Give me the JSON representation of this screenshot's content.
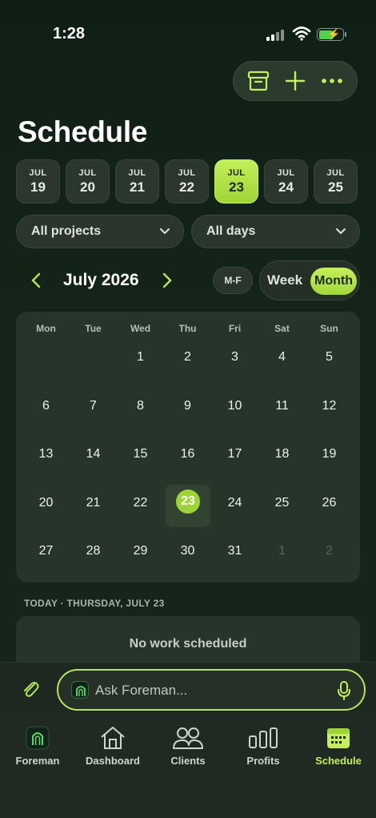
{
  "status": {
    "time": "1:28"
  },
  "header": {
    "title": "Schedule"
  },
  "toolbar": {
    "icons": [
      "archive-icon",
      "plus-icon",
      "more-icon"
    ]
  },
  "date_strip": [
    {
      "month": "JUL",
      "day": "19"
    },
    {
      "month": "JUL",
      "day": "20"
    },
    {
      "month": "JUL",
      "day": "21"
    },
    {
      "month": "JUL",
      "day": "22"
    },
    {
      "month": "JUL",
      "day": "23",
      "selected": true
    },
    {
      "month": "JUL",
      "day": "24"
    },
    {
      "month": "JUL",
      "day": "25"
    }
  ],
  "filters": {
    "projects": "All projects",
    "days": "All days"
  },
  "month_nav": {
    "label": "July 2026",
    "mf_label": "M-F",
    "week_label": "Week",
    "month_label": "Month",
    "active_view": "Month"
  },
  "calendar": {
    "weekdays": [
      "Mon",
      "Tue",
      "Wed",
      "Thu",
      "Fri",
      "Sat",
      "Sun"
    ],
    "weeks": [
      [
        "",
        "",
        "1",
        "2",
        "3",
        "4",
        "5"
      ],
      [
        "6",
        "7",
        "8",
        "9",
        "10",
        "11",
        "12"
      ],
      [
        "13",
        "14",
        "15",
        "16",
        "17",
        "18",
        "19"
      ],
      [
        "20",
        "21",
        "22",
        "23",
        "24",
        "25",
        "26"
      ],
      [
        "27",
        "28",
        "29",
        "30",
        "31",
        "1",
        "2"
      ]
    ],
    "today": "23"
  },
  "agenda": {
    "today_label": "TODAY · THURSDAY, JULY 23",
    "empty_text": "No work scheduled"
  },
  "ask": {
    "placeholder": "Ask Foreman..."
  },
  "tabs": [
    {
      "label": "Foreman",
      "icon": "foreman-logo-icon",
      "active": false
    },
    {
      "label": "Dashboard",
      "icon": "home-icon",
      "active": false
    },
    {
      "label": "Clients",
      "icon": "clients-icon",
      "active": false
    },
    {
      "label": "Profits",
      "icon": "bar-chart-icon",
      "active": false
    },
    {
      "label": "Schedule",
      "icon": "calendar-icon",
      "active": true
    }
  ],
  "colors": {
    "accent": "#b9e55a",
    "background": "#142419",
    "card": "#27342a"
  }
}
